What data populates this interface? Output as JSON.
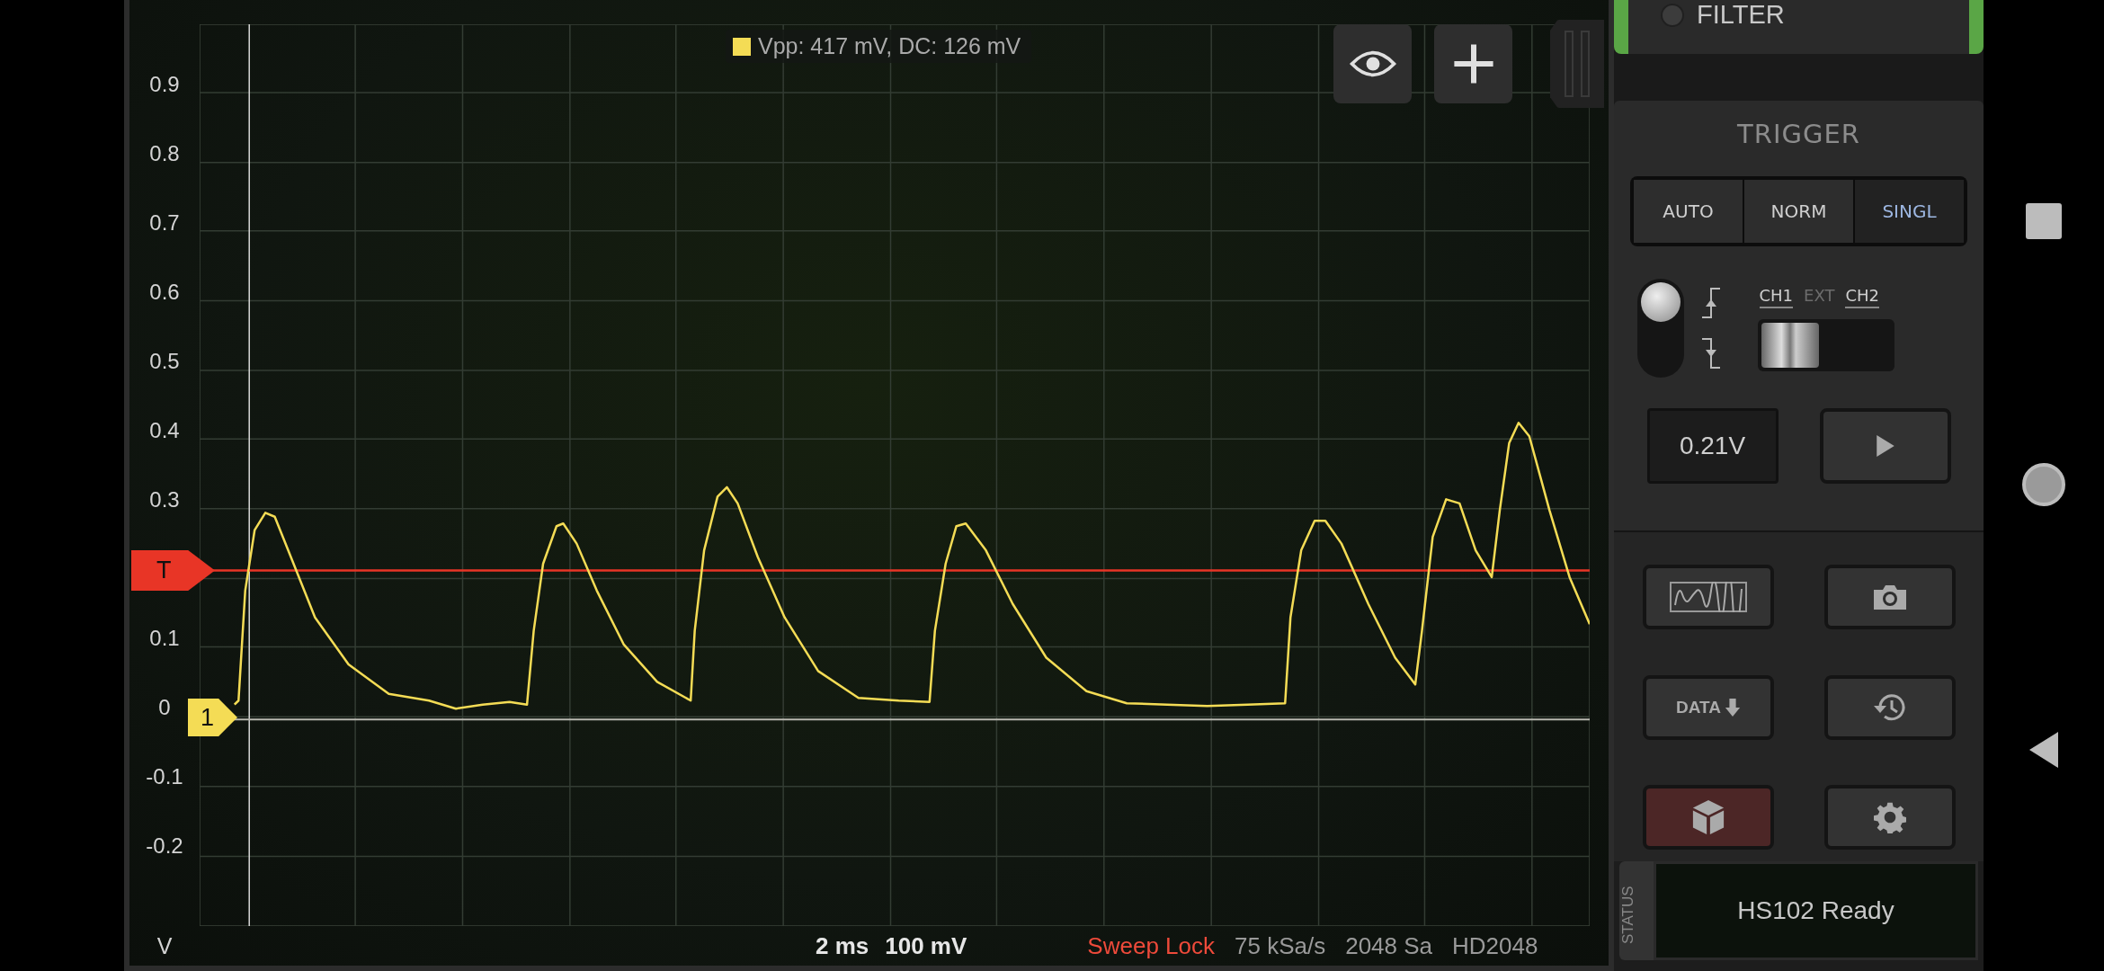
{
  "measurement": {
    "color": "#f4dc55",
    "text": "Vpp: 417 mV, DC: 126 mV"
  },
  "y_axis": {
    "labels": [
      "0.9",
      "0.8",
      "0.7",
      "0.6",
      "0.5",
      "0.4",
      "0.3",
      "0.1",
      "0",
      "-0.1",
      "-0.2"
    ],
    "unit": "V"
  },
  "markers": [
    {
      "kind": "trigger",
      "label": "T",
      "color": "#e83526"
    },
    {
      "kind": "channel",
      "label": "1",
      "color": "#f4dc55"
    }
  ],
  "readout": [
    {
      "kind": "scale",
      "text": "2 ms"
    },
    {
      "kind": "scale",
      "text": "100 mV"
    },
    {
      "kind": "alert",
      "text": "Sweep Lock"
    },
    {
      "kind": "info",
      "text": "75 kSa/s"
    },
    {
      "kind": "info",
      "text": "2048 Sa"
    },
    {
      "kind": "info",
      "text": "HD2048"
    }
  ],
  "filter": {
    "label": "FILTER",
    "on": false
  },
  "trigger": {
    "title": "TRIGGER",
    "modes": [
      {
        "label": "AUTO",
        "selected": false
      },
      {
        "label": "NORM",
        "selected": false
      },
      {
        "label": "SINGL",
        "selected": true
      }
    ],
    "slope_rising": true,
    "sources": [
      {
        "label": "CH1",
        "selected": true,
        "disabled": false
      },
      {
        "label": "EXT",
        "selected": false,
        "disabled": true
      },
      {
        "label": "CH2",
        "selected": false,
        "disabled": false
      }
    ],
    "level": "0.21V"
  },
  "tools": [
    {
      "kind": "waveform",
      "active": false
    },
    {
      "kind": "camera",
      "active": false
    },
    {
      "kind": "data",
      "label": "DATA",
      "active": false
    },
    {
      "kind": "history",
      "active": false
    },
    {
      "kind": "cube",
      "active": true
    },
    {
      "kind": "settings",
      "active": false
    }
  ],
  "status": {
    "tab": "STATUS",
    "text": "HS102 Ready"
  }
}
